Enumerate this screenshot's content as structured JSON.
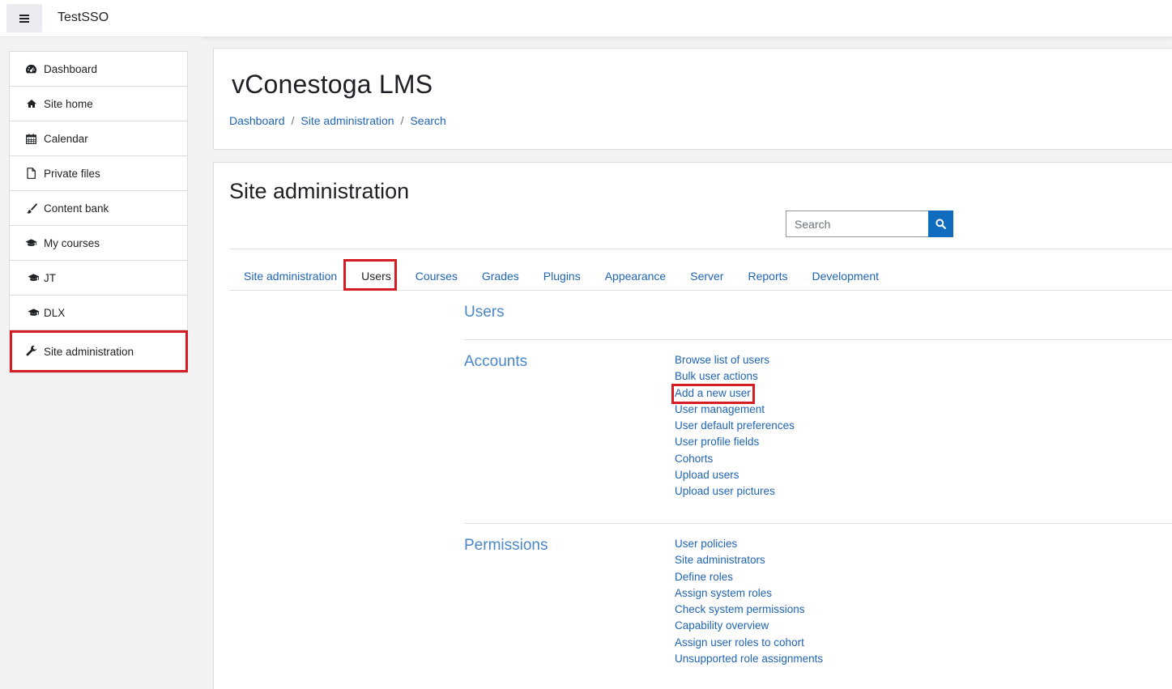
{
  "navbar": {
    "site_name": "TestSSO",
    "menu_icon": "hamburger-icon"
  },
  "sidebar": {
    "items": [
      {
        "label": "Dashboard",
        "icon": "dashboard-icon"
      },
      {
        "label": "Site home",
        "icon": "home-icon"
      },
      {
        "label": "Calendar",
        "icon": "calendar-icon"
      },
      {
        "label": "Private files",
        "icon": "file-icon"
      },
      {
        "label": "Content bank",
        "icon": "brush-icon"
      },
      {
        "label": "My courses",
        "icon": "graduation-cap-icon"
      },
      {
        "label": "JT",
        "icon": "graduation-cap-icon"
      },
      {
        "label": "DLX",
        "icon": "graduation-cap-icon"
      },
      {
        "label": "Site administration",
        "icon": "wrench-icon"
      }
    ]
  },
  "header": {
    "title": "vConestoga LMS",
    "breadcrumb": [
      "Dashboard",
      "Site administration",
      "Search"
    ],
    "breadcrumb_separator": "/"
  },
  "main": {
    "title": "Site administration",
    "search": {
      "placeholder": "Search",
      "icon": "search-icon"
    },
    "tabs": [
      "Site administration",
      "Users",
      "Courses",
      "Grades",
      "Plugins",
      "Appearance",
      "Server",
      "Reports",
      "Development"
    ],
    "active_tab": "Users",
    "section_heading": "Users",
    "categories": [
      {
        "title": "Accounts",
        "links": [
          "Browse list of users",
          "Bulk user actions",
          "Add a new user",
          "User management",
          "User default preferences",
          "User profile fields",
          "Cohorts",
          "Upload users",
          "Upload user pictures"
        ]
      },
      {
        "title": "Permissions",
        "links": [
          "User policies",
          "Site administrators",
          "Define roles",
          "Assign system roles",
          "Check system permissions",
          "Capability overview",
          "Assign user roles to cohort",
          "Unsupported role assignments"
        ]
      }
    ]
  },
  "colors": {
    "link": "#1f64b4",
    "category_title": "#4a87c7",
    "primary_button": "#0f6cbf",
    "annotation_red": "#d71d24"
  }
}
